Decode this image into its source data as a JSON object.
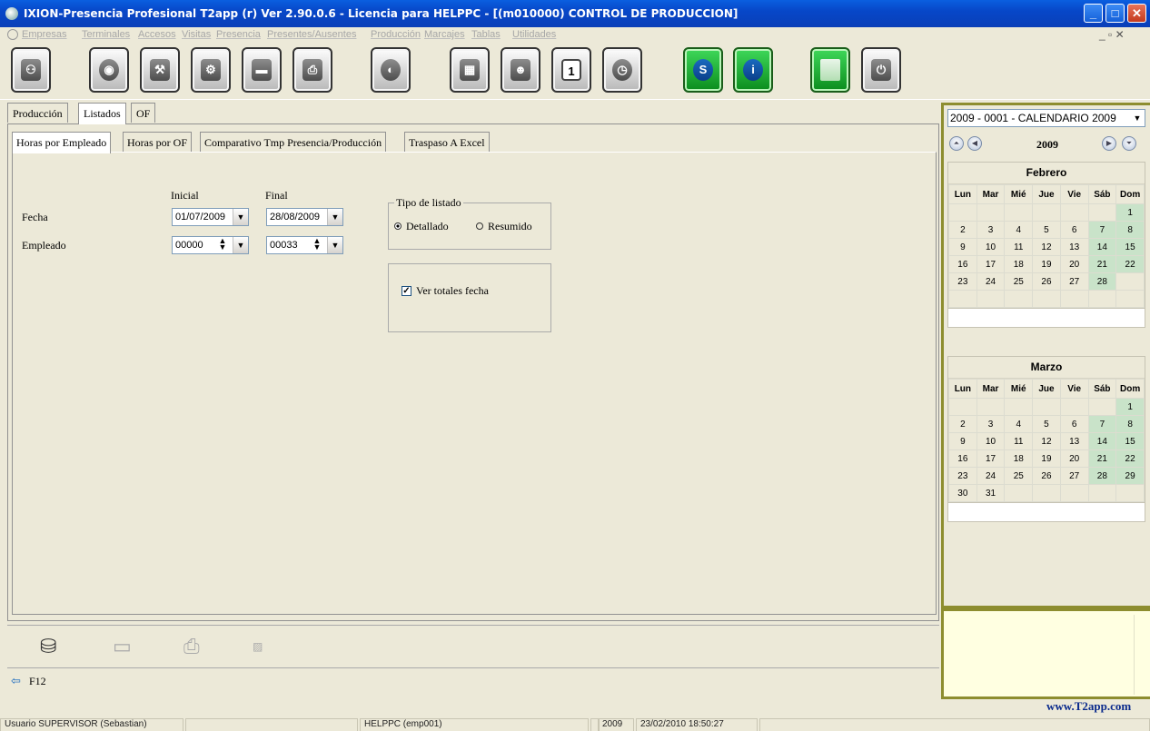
{
  "window": {
    "title": "IXION-Presencia Profesional T2app (r) Ver 2.90.0.6   -   Licencia para HELPPC - [(m010000)  CONTROL DE PRODUCCION]",
    "minimize": "_",
    "maximize": "□",
    "close": "✕",
    "mdi_controls": "_  ▫  ✕"
  },
  "menu": [
    "Empresas",
    "Terminales",
    "Accesos",
    "Visitas",
    "Presencia",
    "Presentes/Ausentes",
    "Producción",
    "Marcajes",
    "Tablas",
    "Utilidades"
  ],
  "toolbar_icons": [
    "people-icon",
    "power-plug-icon",
    "wrench-icon",
    "gear-icon",
    "terminal-icon",
    "printer-icon",
    "compass-icon",
    "map-icon",
    "person-icon",
    "calendar-icon",
    "clock-icon",
    "skype-icon",
    "info-icon",
    "calculator-icon",
    "power-icon"
  ],
  "toolbar_calendar_text": "1",
  "outer_tabs": [
    "Producción",
    "Listados",
    "OF"
  ],
  "inner_tabs": [
    "Horas por Empleado",
    "Horas por OF",
    "Comparativo Tmp Presencia/Producción",
    "Traspaso A Excel"
  ],
  "form": {
    "col_initial": "Inicial",
    "col_final": "Final",
    "fecha_label": "Fecha",
    "empleado_label": "Empleado",
    "fecha_inicial": "01/07/2009",
    "fecha_final": "28/08/2009",
    "empleado_inicial": "00000",
    "empleado_final": "00033"
  },
  "tipo_listado": {
    "legend": "Tipo de listado",
    "option_detallado": "Detallado",
    "option_resumido": "Resumido",
    "selected": "Detallado"
  },
  "ver_totales": {
    "label": "Ver totales fecha",
    "checked": true
  },
  "bottom": {
    "f12_label": "F12"
  },
  "calendar": {
    "selector": "2009 - 0001 - CALENDARIO 2009",
    "year": "2009",
    "weekdays": [
      "Lun",
      "Mar",
      "Mié",
      "Jue",
      "Vie",
      "Sáb",
      "Dom"
    ],
    "months": [
      {
        "name": "Febrero",
        "weeks": [
          [
            "",
            "",
            "",
            "",
            "",
            "",
            "1"
          ],
          [
            "2",
            "3",
            "4",
            "5",
            "6",
            "7",
            "8"
          ],
          [
            "9",
            "10",
            "11",
            "12",
            "13",
            "14",
            "15"
          ],
          [
            "16",
            "17",
            "18",
            "19",
            "20",
            "21",
            "22"
          ],
          [
            "23",
            "24",
            "25",
            "26",
            "27",
            "28",
            ""
          ],
          [
            "",
            "",
            "",
            "",
            "",
            "",
            ""
          ]
        ]
      },
      {
        "name": "Marzo",
        "weeks": [
          [
            "",
            "",
            "",
            "",
            "",
            "",
            "1"
          ],
          [
            "2",
            "3",
            "4",
            "5",
            "6",
            "7",
            "8"
          ],
          [
            "9",
            "10",
            "11",
            "12",
            "13",
            "14",
            "15"
          ],
          [
            "16",
            "17",
            "18",
            "19",
            "20",
            "21",
            "22"
          ],
          [
            "23",
            "24",
            "25",
            "26",
            "27",
            "28",
            "29"
          ],
          [
            "30",
            "31",
            "",
            "",
            "",
            "",
            ""
          ]
        ]
      }
    ]
  },
  "website": "www.T2app.com",
  "status": {
    "user": "Usuario SUPERVISOR (Sebastian)",
    "empty1": "",
    "machine": "HELPPC  (emp001)",
    "empty2": "",
    "year": "2009",
    "datetime": "23/02/2010  18:50:27"
  },
  "colors": {
    "titlebar": "#0747c8",
    "weekend": "#c9e3c9",
    "side_border": "#8d8d2f",
    "link": "#0a2a8c"
  }
}
